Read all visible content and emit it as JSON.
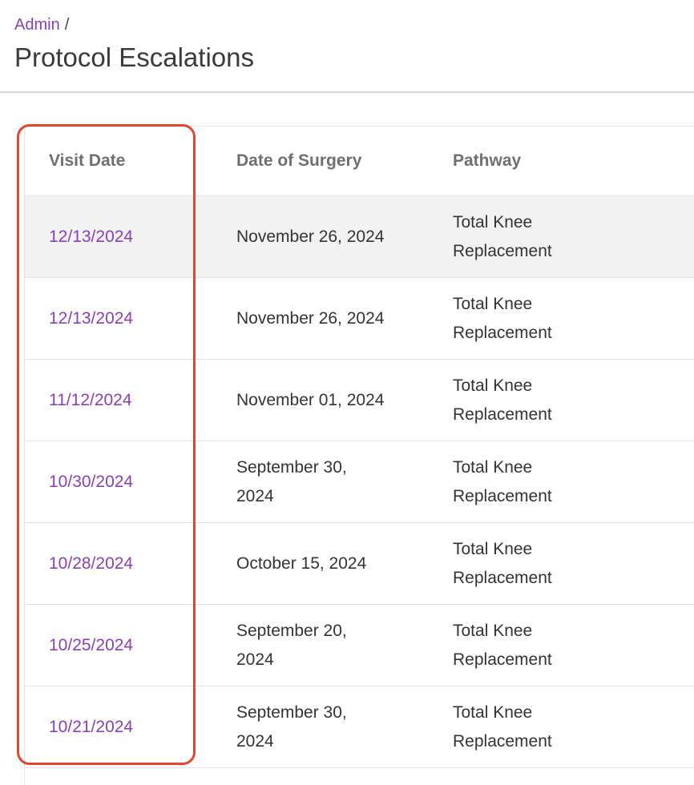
{
  "breadcrumb": {
    "parent": "Admin",
    "separator": "/"
  },
  "page": {
    "title": "Protocol Escalations"
  },
  "table": {
    "columns": [
      "Visit Date",
      "Date of Surgery",
      "Pathway"
    ],
    "rows": [
      {
        "visit_date": "12/13/2024",
        "surgery_date": "November 26, 2024",
        "pathway": "Total Knee Replacement"
      },
      {
        "visit_date": "12/13/2024",
        "surgery_date": "November 26, 2024",
        "pathway": "Total Knee Replacement"
      },
      {
        "visit_date": "11/12/2024",
        "surgery_date": "November 01, 2024",
        "pathway": "Total Knee Replacement"
      },
      {
        "visit_date": "10/30/2024",
        "surgery_date": "September 30, 2024",
        "pathway": "Total Knee Replacement"
      },
      {
        "visit_date": "10/28/2024",
        "surgery_date": "October 15, 2024",
        "pathway": "Total Knee Replacement"
      },
      {
        "visit_date": "10/25/2024",
        "surgery_date": "September 20, 2024",
        "pathway": "Total Knee Replacement"
      },
      {
        "visit_date": "10/21/2024",
        "surgery_date": "September 30, 2024",
        "pathway": "Total Knee Replacement"
      }
    ],
    "hovered_row_index": 0
  },
  "colors": {
    "link": "#8a3fb8",
    "highlight": "#e2462e",
    "hover_row": "#f2f2f2"
  }
}
